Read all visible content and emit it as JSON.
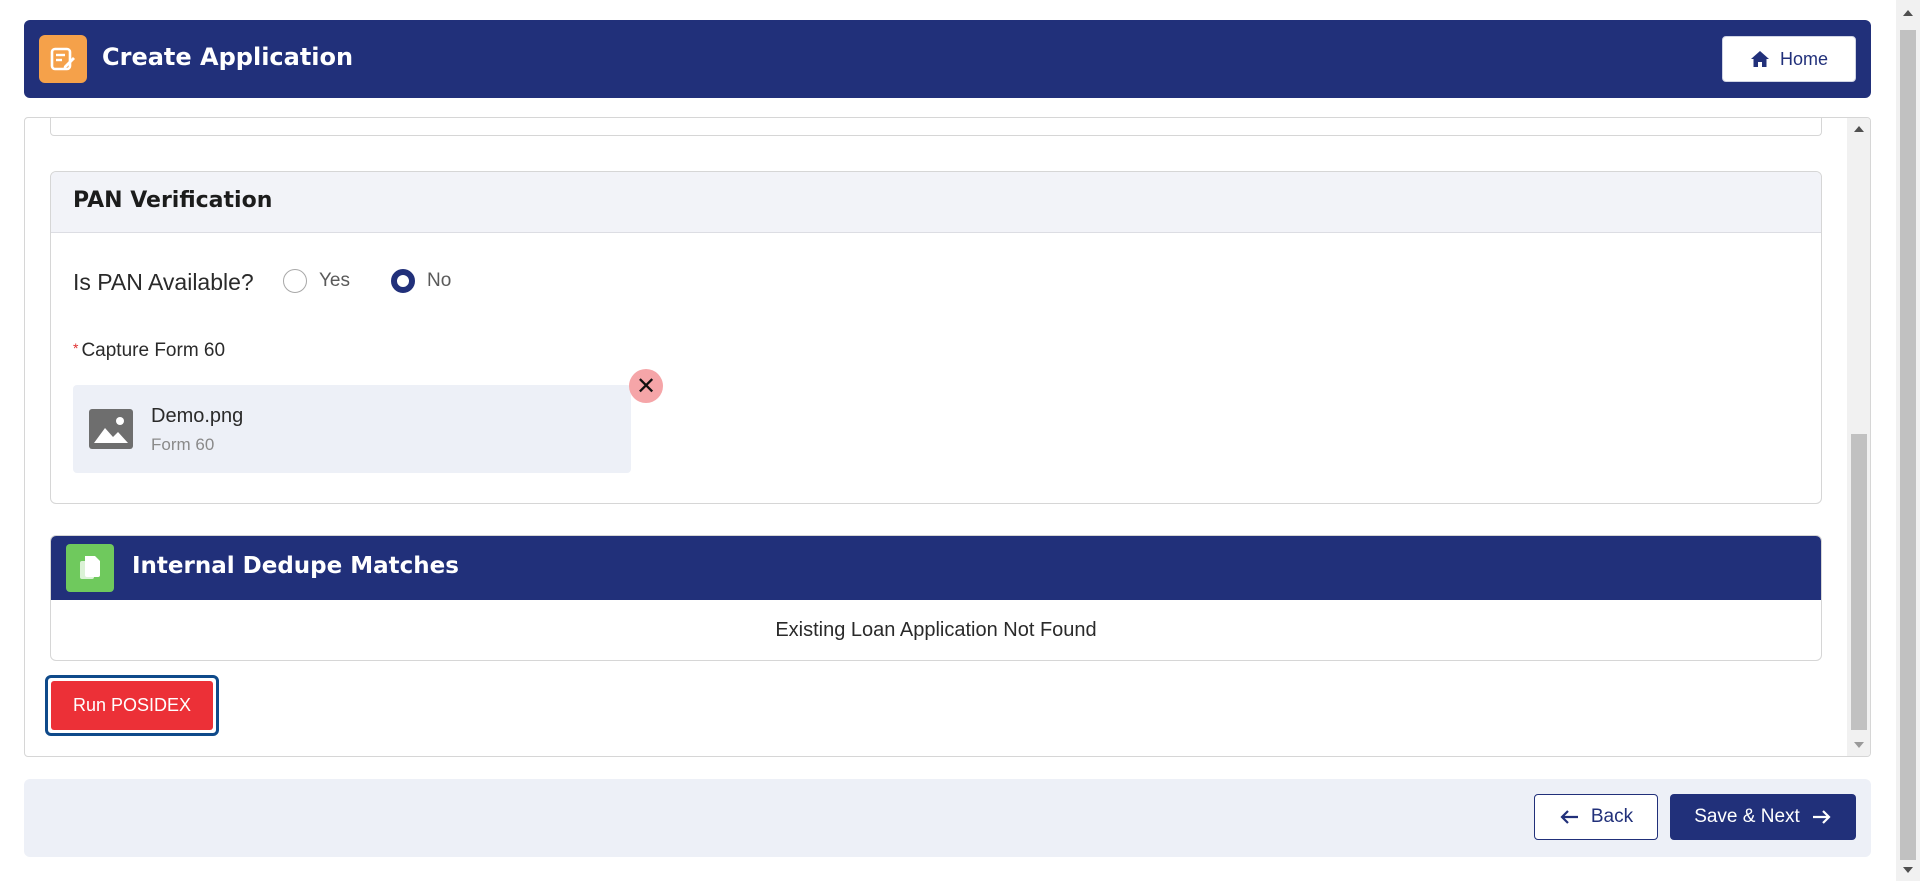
{
  "header": {
    "title": "Create Application",
    "home_label": "Home",
    "icon": "edit-note-icon"
  },
  "pan_verification": {
    "title": "PAN Verification",
    "question": "Is PAN Available?",
    "options": [
      {
        "label": "Yes",
        "selected": false
      },
      {
        "label": "No",
        "selected": true
      }
    ],
    "capture_label": "Capture Form 60",
    "required_marker": "*",
    "file": {
      "name": "Demo.png",
      "type_label": "Form 60",
      "icon": "image-icon"
    },
    "remove_glyph": "✕"
  },
  "dedupe": {
    "title": "Internal Dedupe Matches",
    "icon": "documents-icon",
    "message": "Existing Loan Application Not Found"
  },
  "actions": {
    "run_posidex": "Run POSIDEX",
    "back": "Back",
    "save_next": "Save & Next"
  },
  "colors": {
    "primary": "#21307a",
    "header_icon_bg": "#f5a14a",
    "dedupe_icon_bg": "#6fc95d",
    "danger": "#ec3037",
    "remove_bg": "#f5a5a8",
    "footer_bg": "#edf0f7"
  }
}
